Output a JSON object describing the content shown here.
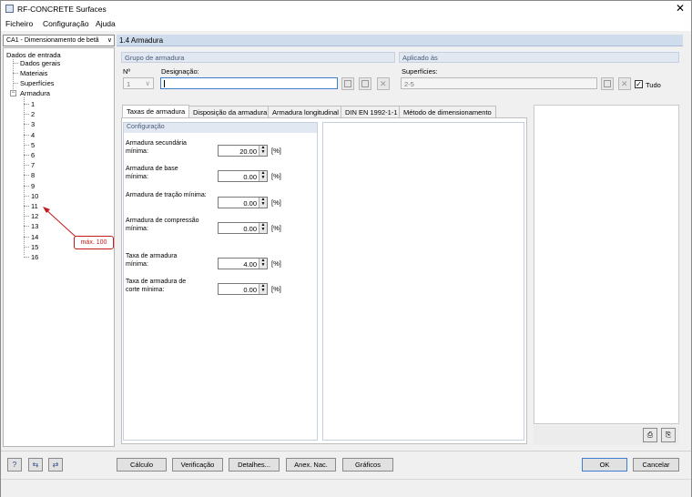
{
  "window": {
    "title": "RF-CONCRETE Surfaces",
    "close_glyph": "✕"
  },
  "menu": [
    "Ficheiro",
    "Configuração",
    "Ajuda"
  ],
  "nav": {
    "selected_case": "CA1 - Dimensionamento de betã",
    "tree": {
      "root": "Dados de entrada",
      "children": [
        "Dados gerais",
        "Materiais",
        "Superfícies"
      ],
      "reinforcement": {
        "label": "Armadura",
        "items": [
          "1",
          "2",
          "3",
          "4",
          "5",
          "6",
          "7",
          "8",
          "9",
          "10",
          "11",
          "12",
          "13",
          "14",
          "15",
          "16"
        ]
      }
    },
    "callout": "máx. 100"
  },
  "header": {
    "title": "1.4 Armadura"
  },
  "reinforcement_group": {
    "title": "Grupo de armadura",
    "no_label": "Nº",
    "no_value": "1",
    "designation_label": "Designação:",
    "designation_value": ""
  },
  "applied_to": {
    "title": "Aplicado às",
    "surfaces_label": "Superfícies:",
    "surfaces_value": "2-5",
    "all_label": "Tudo",
    "all_checked": true
  },
  "tabs": [
    "Taxas de armadura",
    "Disposição da armadura",
    "Armadura longitudinal",
    "DIN EN 1992-1-1",
    "Método de dimensionamento"
  ],
  "active_tab": 0,
  "config": {
    "title": "Configuração",
    "rows": [
      {
        "label1": "Armadura secundária",
        "label2": "mínima:",
        "value": "20.00",
        "unit": "[%]"
      },
      {
        "label1": "Armadura de base",
        "label2": "mínima:",
        "value": "0.00",
        "unit": "[%]"
      },
      {
        "label1": "Armadura de tração mínima:",
        "label2": "",
        "value": "0.00",
        "unit": "[%]"
      },
      {
        "label1": "Armadura de compressão",
        "label2": "mínima:",
        "value": "0.00",
        "unit": "[%]"
      },
      {
        "label1": "Taxa de armadura",
        "label2": "mínima:",
        "value": "4.00",
        "unit": "[%]"
      },
      {
        "label1": "Taxa de armadura de",
        "label2": "corte mínima:",
        "value": "0.00",
        "unit": "[%]"
      }
    ]
  },
  "buttons": {
    "calc": "Cálculo",
    "check": "Verificação",
    "details": "Detalhes...",
    "annex": "Anex. Nac.",
    "graphics": "Gráficos",
    "ok": "OK",
    "cancel": "Cancelar"
  }
}
